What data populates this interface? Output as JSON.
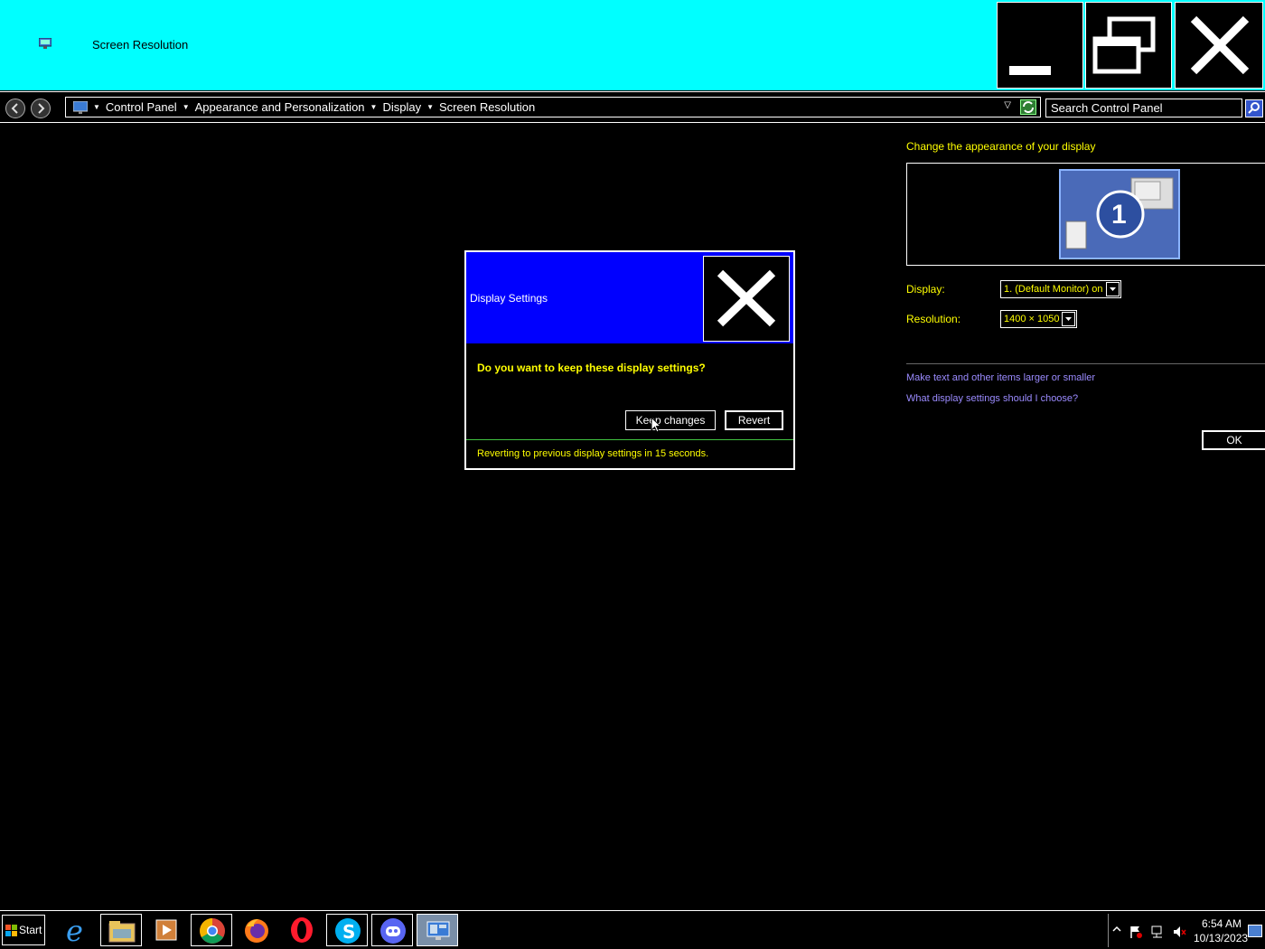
{
  "window": {
    "title": "Screen Resolution"
  },
  "address_bar": {
    "crumbs": [
      "Control Panel",
      "Appearance and Personalization",
      "Display",
      "Screen Resolution"
    ],
    "search_placeholder": "Search Control Panel"
  },
  "panel": {
    "heading": "Change the appearance of your display",
    "monitor_number": "1",
    "display_label": "Display:",
    "display_value": "1. (Default Monitor) on",
    "resolution_label": "Resolution:",
    "resolution_value": "1400 × 1050",
    "links": [
      "Make text and other items larger or smaller",
      "What display settings should I choose?"
    ],
    "ok_label": "OK"
  },
  "dialog": {
    "title": "Display Settings",
    "question": "Do you want to keep these display settings?",
    "keep_label": "Keep changes",
    "revert_label": "Revert",
    "status": "Reverting to previous display settings in 15 seconds."
  },
  "taskbar": {
    "start_label": "Start",
    "apps": [
      "internet-explorer-icon",
      "file-explorer-icon",
      "media-player-icon",
      "chrome-icon",
      "firefox-icon",
      "opera-icon",
      "skype-icon",
      "discord-icon",
      "control-panel-icon"
    ],
    "time": "6:54 AM",
    "date": "10/13/2023"
  },
  "colors": {
    "titlebar": "#00ffff",
    "dialog_title": "#0000ff",
    "text_highlight": "#ffff00",
    "link": "#9b8bff"
  }
}
